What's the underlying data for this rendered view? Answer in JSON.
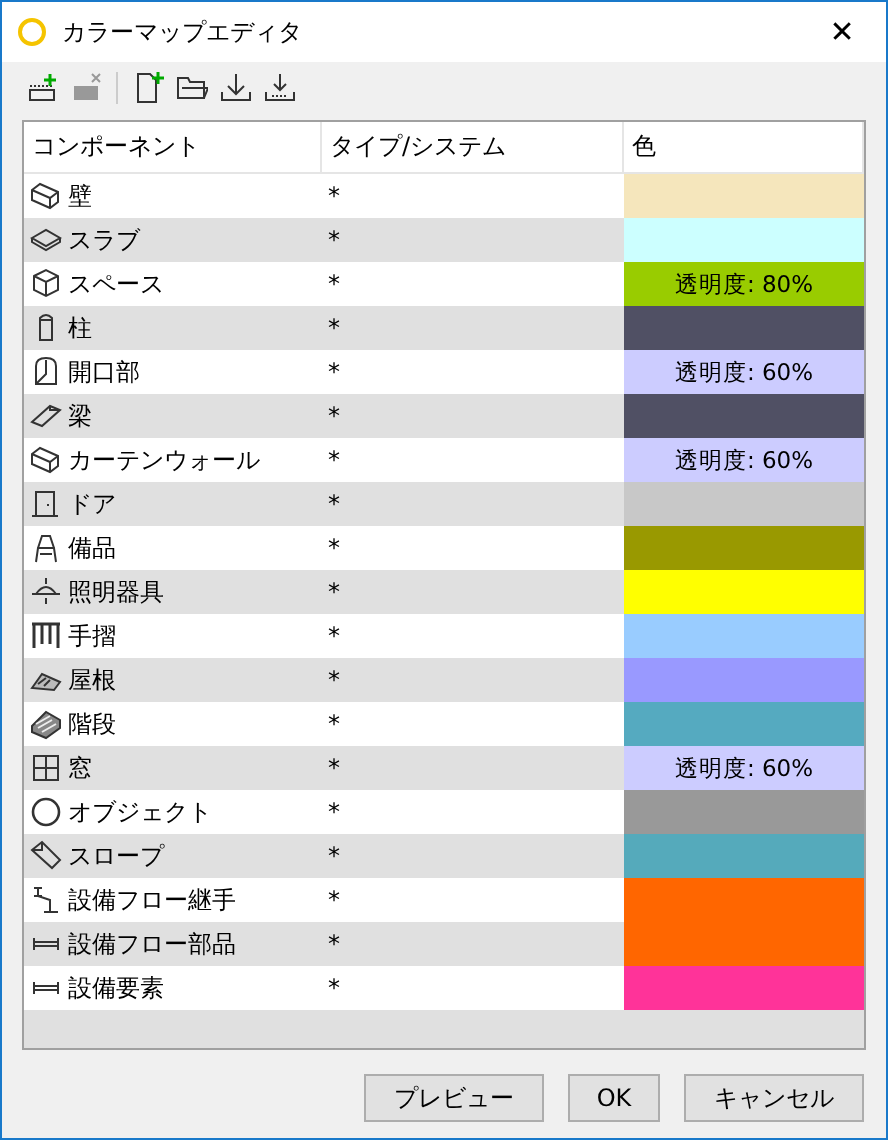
{
  "window": {
    "title": "カラーマップエディタ",
    "close": "✕"
  },
  "toolbar": [
    {
      "kind": "add",
      "disabled": false
    },
    {
      "kind": "remove",
      "disabled": true
    },
    {
      "kind": "new",
      "disabled": false
    },
    {
      "kind": "open",
      "disabled": false
    },
    {
      "kind": "import",
      "disabled": false
    },
    {
      "kind": "export",
      "disabled": false
    }
  ],
  "table": {
    "columns": [
      "コンポーネント",
      "タイプ/システム",
      "色"
    ],
    "rows": [
      {
        "kind": "wall",
        "name": "壁",
        "type": "*",
        "color": "#f5e6bc"
      },
      {
        "kind": "slab",
        "name": "スラブ",
        "type": "*",
        "color": "#ccffff"
      },
      {
        "kind": "cube",
        "name": "スペース",
        "type": "*",
        "color": "#99cc00",
        "label": "透明度: 80%"
      },
      {
        "kind": "column",
        "name": "柱",
        "type": "*",
        "color": "#505064"
      },
      {
        "kind": "opening",
        "name": "開口部",
        "type": "*",
        "color": "#ccccff",
        "label": "透明度: 60%"
      },
      {
        "kind": "beam",
        "name": "梁",
        "type": "*",
        "color": "#505064"
      },
      {
        "kind": "wall",
        "name": "カーテンウォール",
        "type": "*",
        "color": "#ccccff",
        "label": "透明度: 60%"
      },
      {
        "kind": "door",
        "name": "ドア",
        "type": "*",
        "color": "#c8c8c8"
      },
      {
        "kind": "chair",
        "name": "備品",
        "type": "*",
        "color": "#999900"
      },
      {
        "kind": "lamp",
        "name": "照明器具",
        "type": "*",
        "color": "#ffff00"
      },
      {
        "kind": "railing",
        "name": "手摺",
        "type": "*",
        "color": "#99ccff"
      },
      {
        "kind": "roof",
        "name": "屋根",
        "type": "*",
        "color": "#9999ff"
      },
      {
        "kind": "stair",
        "name": "階段",
        "type": "*",
        "color": "#55aac0"
      },
      {
        "kind": "window",
        "name": "窓",
        "type": "*",
        "color": "#ccccff",
        "label": "透明度: 60%"
      },
      {
        "kind": "object",
        "name": "オブジェクト",
        "type": "*",
        "color": "#999999"
      },
      {
        "kind": "ramp",
        "name": "スロープ",
        "type": "*",
        "color": "#55aabb"
      },
      {
        "kind": "fitting",
        "name": "設備フロー継手",
        "type": "*",
        "color": "#ff6600"
      },
      {
        "kind": "segment",
        "name": "設備フロー部品",
        "type": "*",
        "color": "#ff6600"
      },
      {
        "kind": "segment",
        "name": "設備要素",
        "type": "*",
        "color": "#ff3399"
      }
    ]
  },
  "buttons": [
    "プレビュー",
    "OK",
    "キャンセル"
  ]
}
